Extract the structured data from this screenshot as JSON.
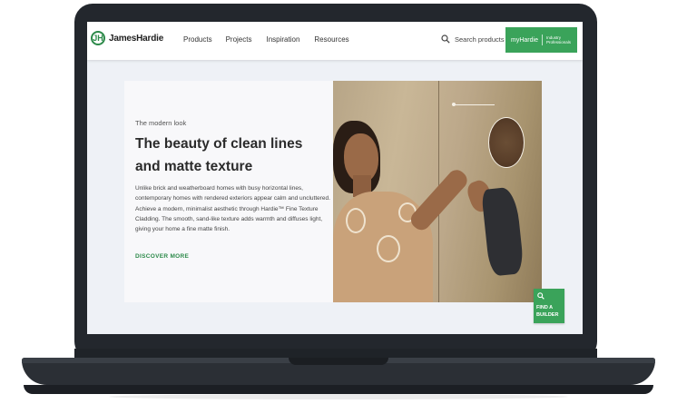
{
  "header": {
    "brand": "JamesHardie",
    "brand_mark": "JH",
    "nav": [
      "Products",
      "Projects",
      "Inspiration",
      "Resources"
    ],
    "search_label": "Search products",
    "pro_button": {
      "brand": "myHardie",
      "label": "Industry Professionals"
    }
  },
  "hero": {
    "eyebrow": "The modern look",
    "headline": "The beauty of clean lines and matte texture",
    "body": "Unlike brick and weatherboard homes with busy horizontal lines, contemporary homes with rendered exteriors appear calm and uncluttered. Achieve a modern, minimalist aesthetic through Hardie™ Fine Texture Cladding. The smooth, sand-like texture adds warmth and diffuses light, giving your home a fine matte finish.",
    "cta": "DISCOVER MORE"
  },
  "find_builder": {
    "label": "FIND A BUILDER"
  },
  "colors": {
    "brand_green": "#3aa35a",
    "cta_green": "#2d8a4a",
    "laptop": "#23272d"
  },
  "icons": {
    "search": "search-icon",
    "find": "search-icon",
    "logo": "jameshardie-logo-icon"
  }
}
